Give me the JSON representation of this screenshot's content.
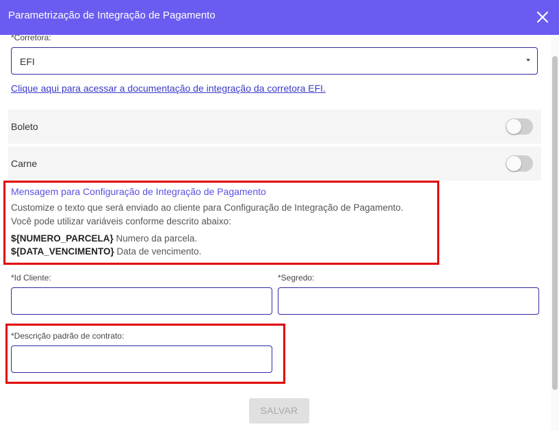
{
  "dialog": {
    "title": "Parametrização de Integração de Pagamento"
  },
  "broker": {
    "label": "*Corretora:",
    "value": "EFI",
    "doc_link": "Clique aqui para acessar a documentação de integração da corretora EFI."
  },
  "toggles": [
    {
      "label": "Boleto",
      "enabled": false
    },
    {
      "label": "Carne",
      "enabled": false
    }
  ],
  "message": {
    "title": "Mensagem para Configuração de Integração de Pagamento",
    "line1": "Customize o texto que será enviado ao cliente para Configuração de Integração de Pagamento.",
    "line2": "Você pode utilizar variáveis conforme descrito abaixo:",
    "variables": [
      {
        "name": "${NUMERO_PARCELA}",
        "description": "Numero da parcela."
      },
      {
        "name": "${DATA_VENCIMENTO}",
        "description": "Data de vencimento."
      }
    ]
  },
  "fields": {
    "client_id_label": "*Id Cliente:",
    "client_id_value": "",
    "secret_label": "*Segredo:",
    "secret_value": "",
    "contract_desc_label": "*Descrição padrão de contrato:",
    "contract_desc_value": ""
  },
  "actions": {
    "save_label": "SALVAR"
  },
  "colors": {
    "header": "#6a5cf0",
    "accent": "#5b4fe0",
    "link": "#3a39c8",
    "highlight": "#e00000"
  }
}
